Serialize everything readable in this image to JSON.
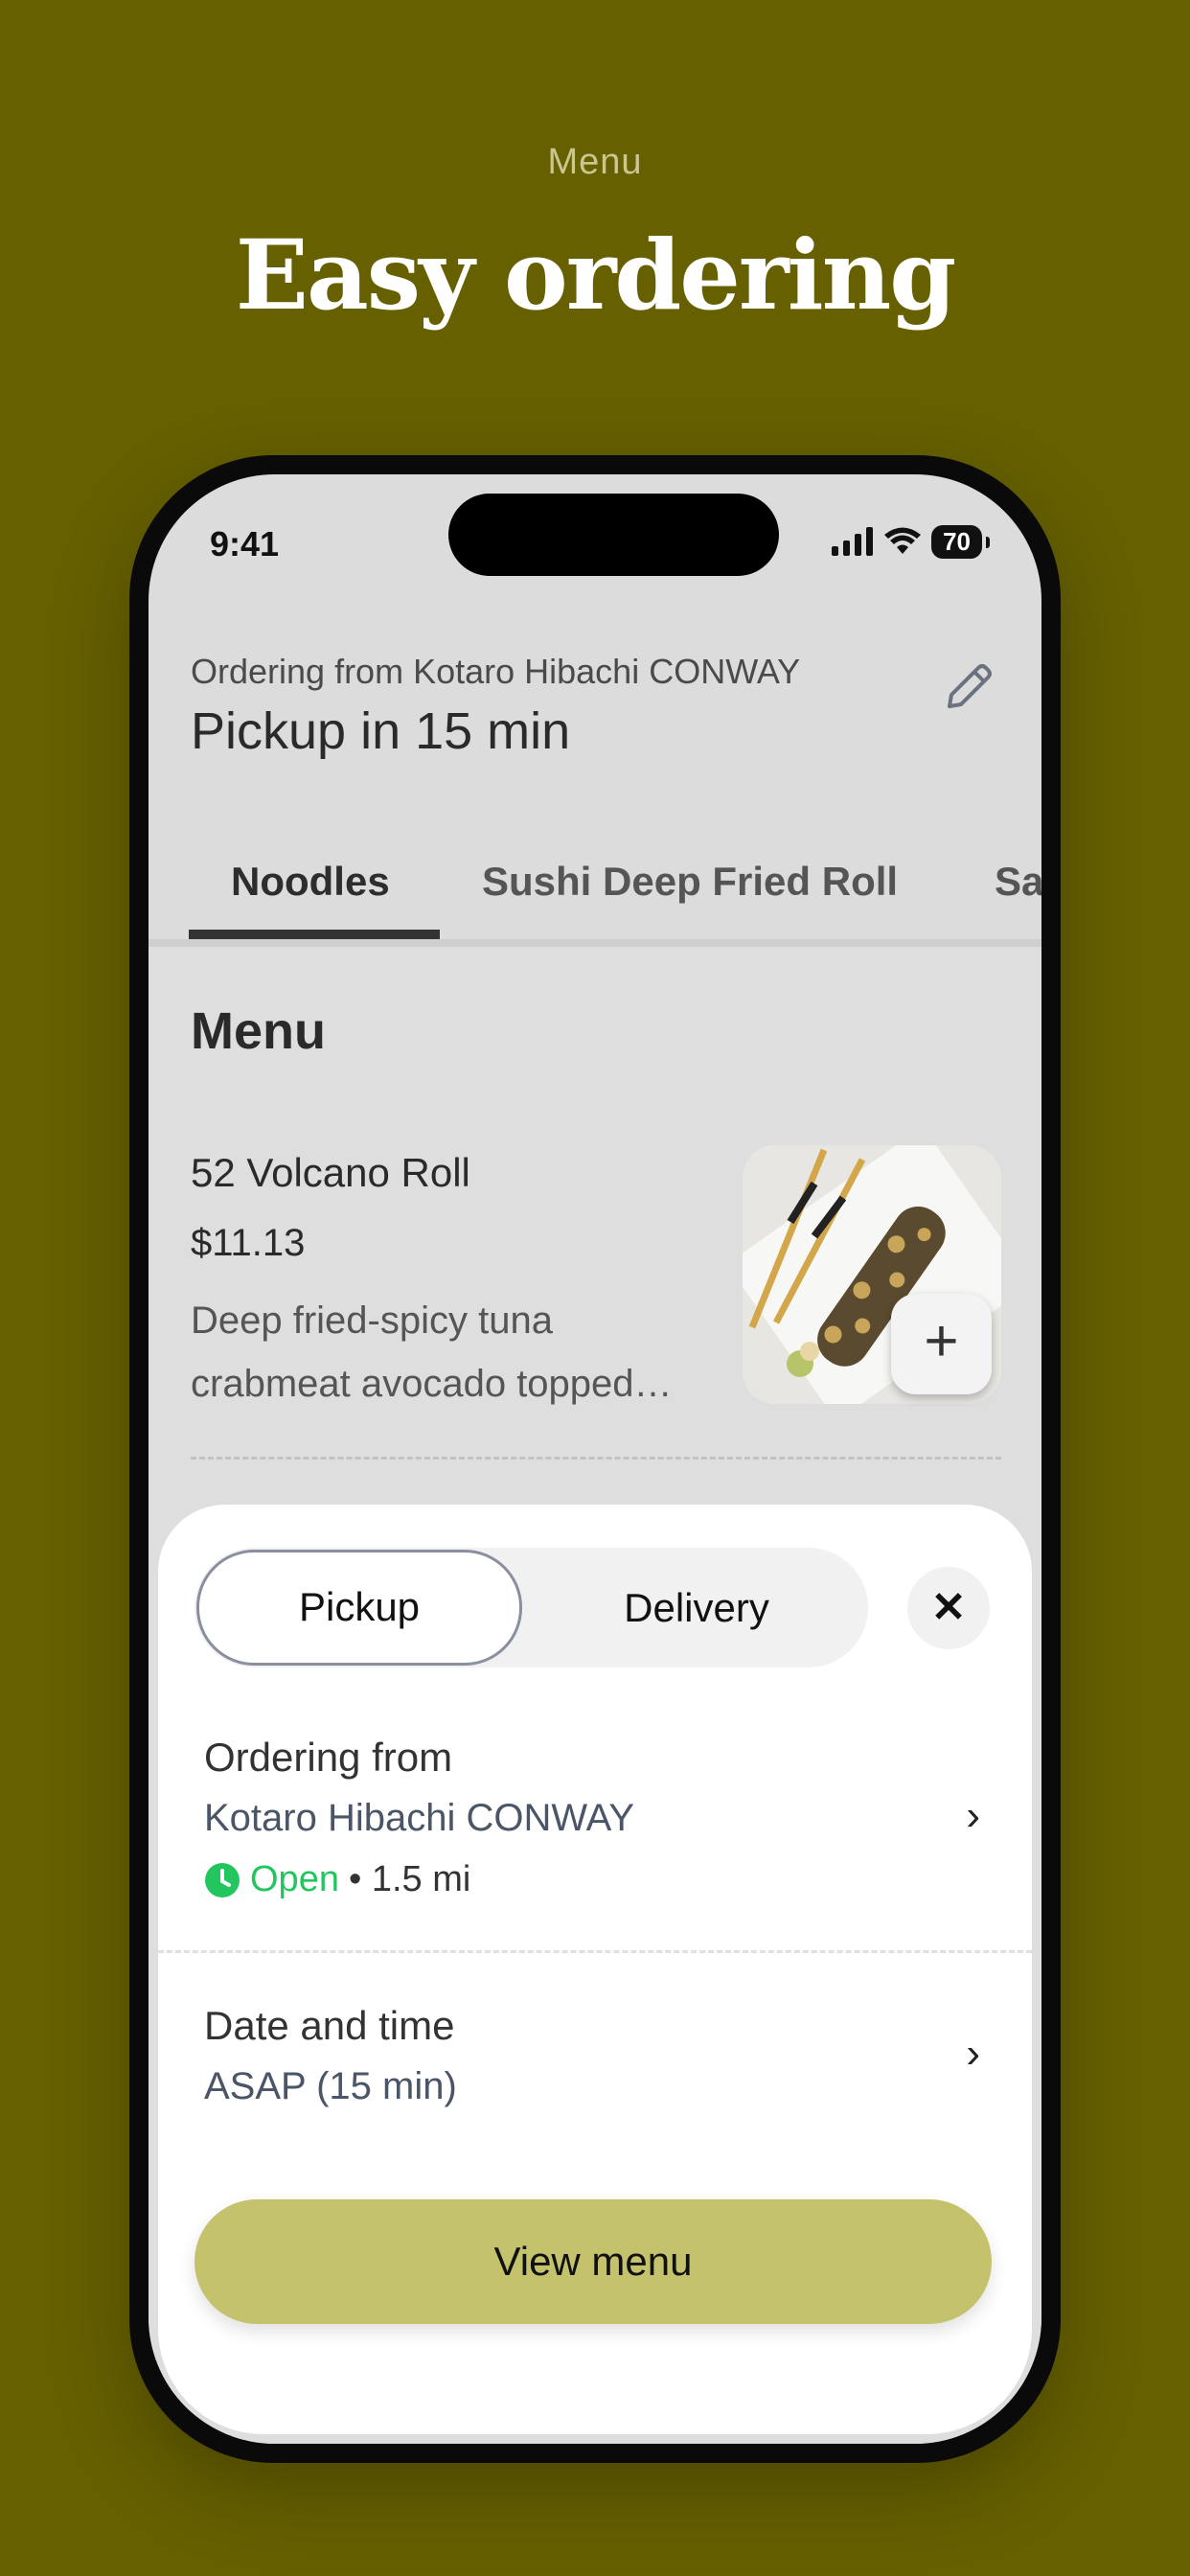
{
  "hero": {
    "subtitle": "Menu",
    "title": "Easy ordering"
  },
  "status_bar": {
    "time": "9:41",
    "battery": "70"
  },
  "header": {
    "ordering_from": "Ordering from Kotaro Hibachi CONWAY",
    "pickup_title": "Pickup in 15 min"
  },
  "tabs": [
    {
      "label": "Noodles",
      "active": true
    },
    {
      "label": "Sushi Deep Fried Roll",
      "active": false
    },
    {
      "label": "Sa",
      "active": false
    }
  ],
  "menu": {
    "heading": "Menu",
    "items": [
      {
        "name": "52 Volcano Roll",
        "price": "$11.13",
        "description": "Deep fried-spicy tuna crabmeat avocado topped…",
        "add_label": "+"
      }
    ]
  },
  "sheet": {
    "pickup_label": "Pickup",
    "delivery_label": "Delivery",
    "close_label": "✕",
    "ordering_from_label": "Ordering from",
    "store_name": "Kotaro Hibachi CONWAY",
    "open_status": "Open",
    "distance": "• 1.5 mi",
    "date_time_label": "Date and time",
    "date_time_value": "ASAP (15 min)",
    "view_menu_label": "View menu",
    "chevron": "›"
  },
  "colors": {
    "background": "#666000",
    "accent": "#c4c26c",
    "open_green": "#22c55e"
  }
}
